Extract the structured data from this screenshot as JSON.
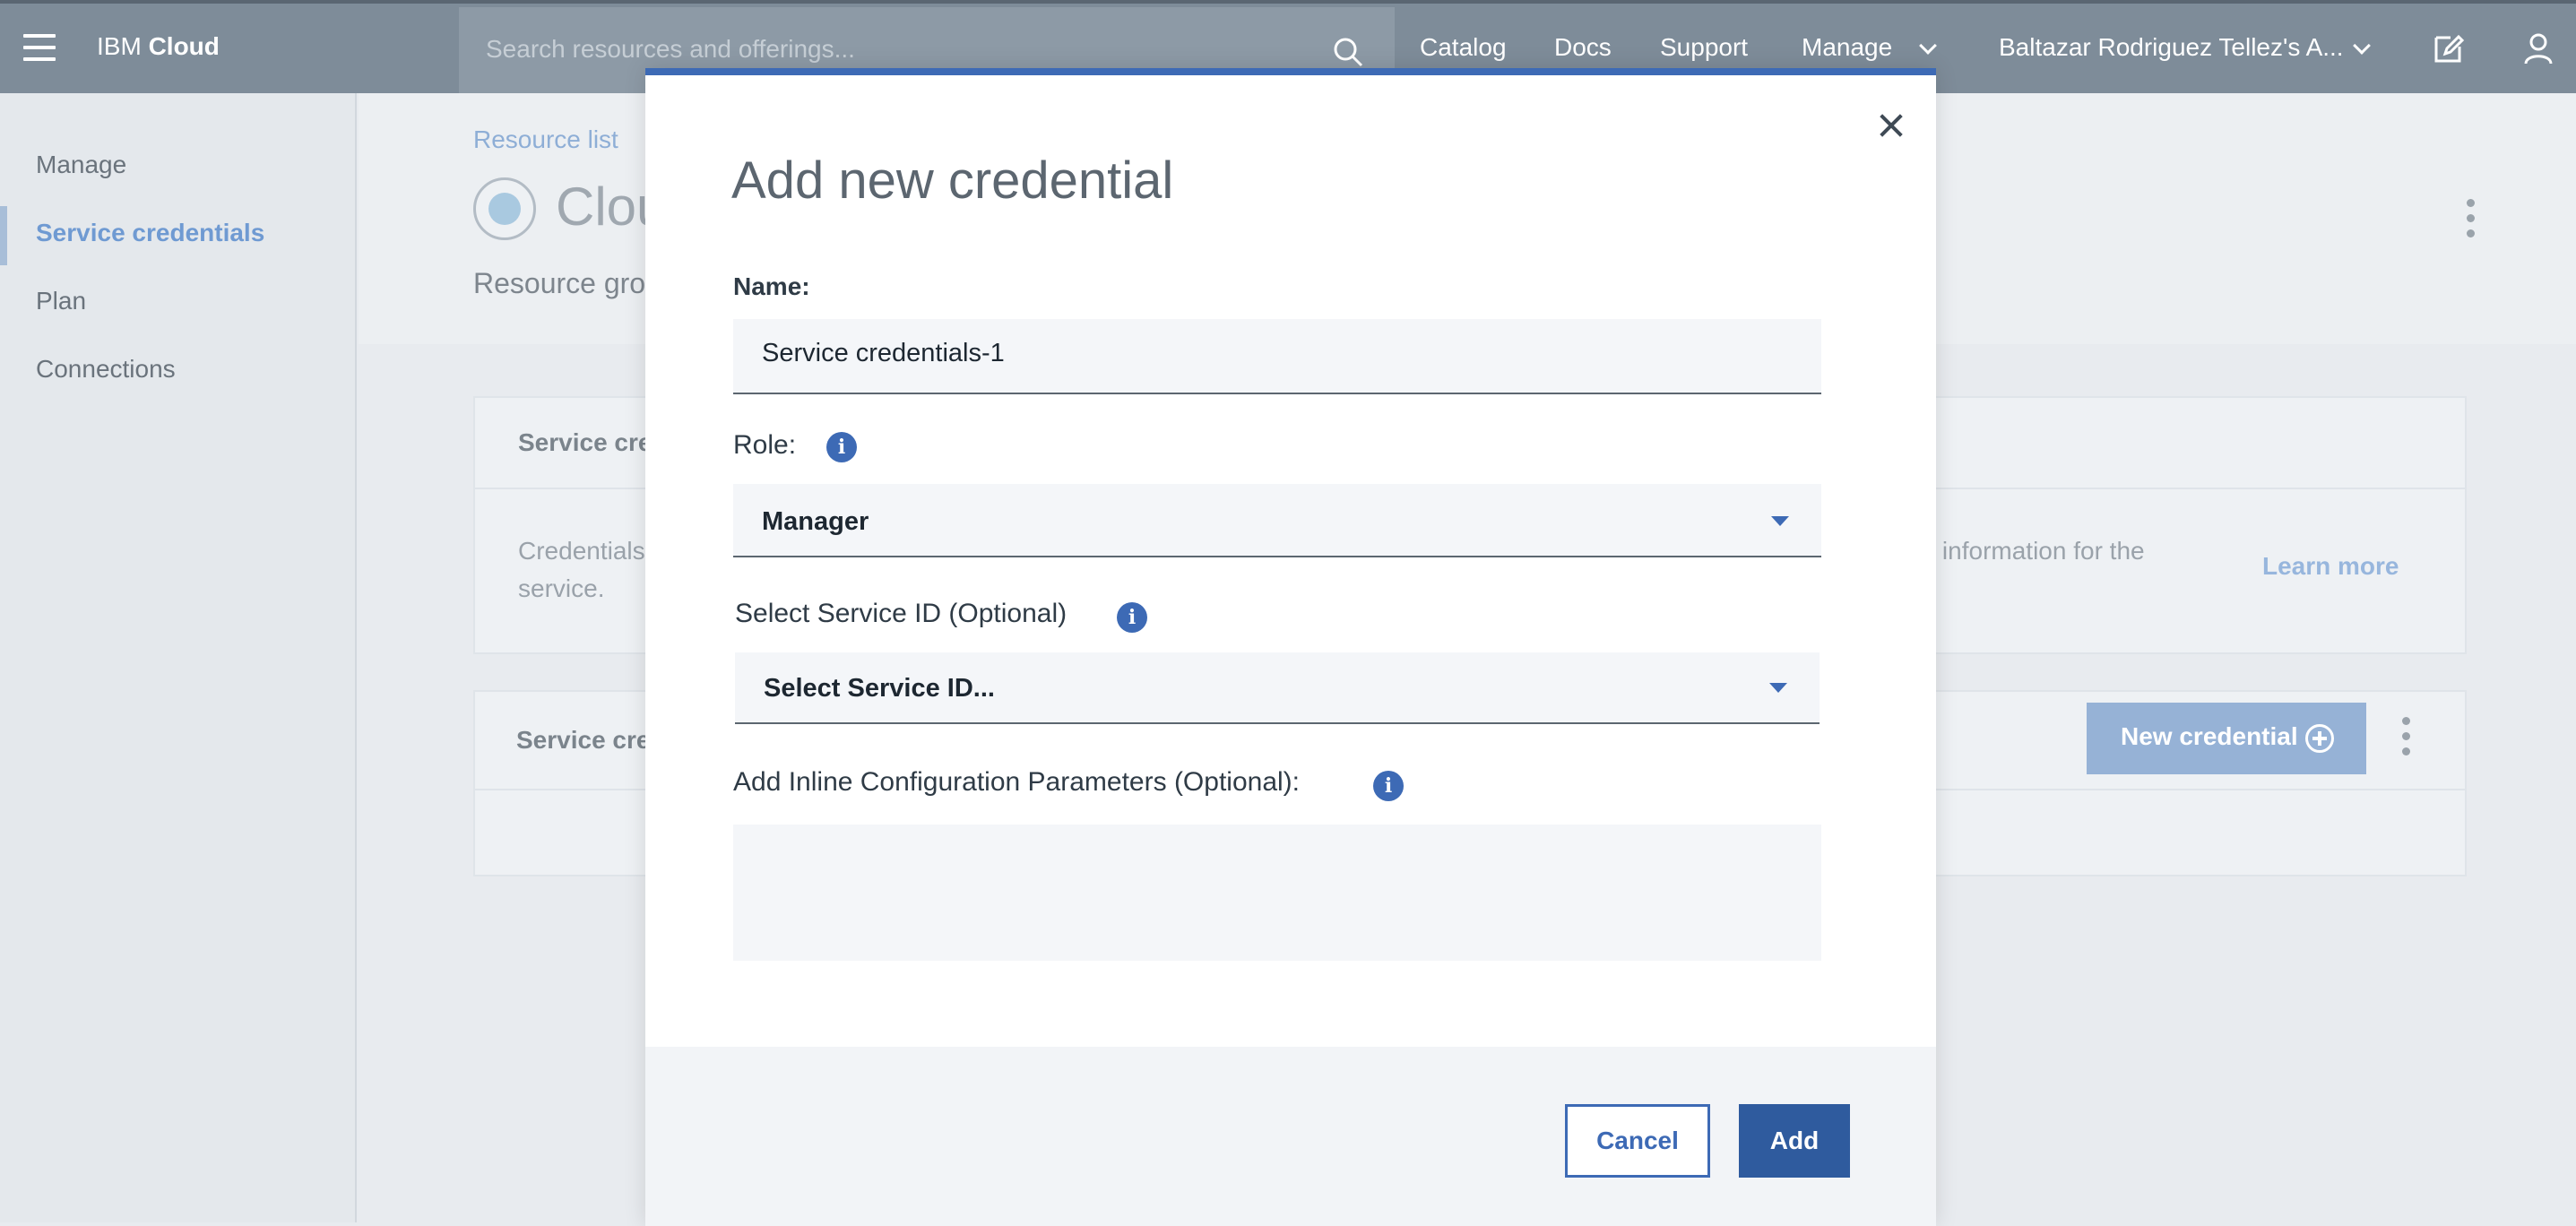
{
  "topbar": {
    "brand_prefix": "IBM",
    "brand_name": "Cloud",
    "search_placeholder": "Search resources and offerings...",
    "nav": [
      "Catalog",
      "Docs",
      "Support",
      "Manage"
    ],
    "account": "Baltazar Rodriguez Tellez's A..."
  },
  "sidebar": {
    "items": [
      {
        "label": "Manage",
        "active": false
      },
      {
        "label": "Service credentials",
        "active": true
      },
      {
        "label": "Plan",
        "active": false
      },
      {
        "label": "Connections",
        "active": false
      }
    ]
  },
  "page": {
    "breadcrumb": "Resource list",
    "title_visible": "Clou",
    "resource_group_visible": "Resource grou",
    "panel1_title_visible": "Service cre",
    "panel1_text_left_line1": "Credentials",
    "panel1_text_left_line2": "service.",
    "panel1_text_right": "tion information for the",
    "learn_more": "Learn more",
    "panel2_title_visible": "Service cre",
    "new_credential": "New credential"
  },
  "modal": {
    "title": "Add new credential",
    "name_label": "Name:",
    "name_value": "Service credentials-1",
    "role_label": "Role:",
    "role_value": "Manager",
    "service_id_label": "Select Service ID (Optional)",
    "service_id_value": "Select Service ID...",
    "params_label": "Add Inline Configuration Parameters (Optional):",
    "params_value": "",
    "cancel": "Cancel",
    "add": "Add",
    "info_glyph": "i"
  },
  "colors": {
    "topbar": "#7e8c99",
    "accent": "#3d6ab5",
    "primary_button": "#2f5b9e",
    "sidebar_active": "#6f9ad2"
  },
  "icons": [
    "hamburger-icon",
    "search-icon",
    "chevron-down-icon",
    "edit-icon",
    "user-icon",
    "info-icon",
    "close-icon",
    "add-circle-icon",
    "overflow-menu-icon",
    "service-logo-icon"
  ]
}
